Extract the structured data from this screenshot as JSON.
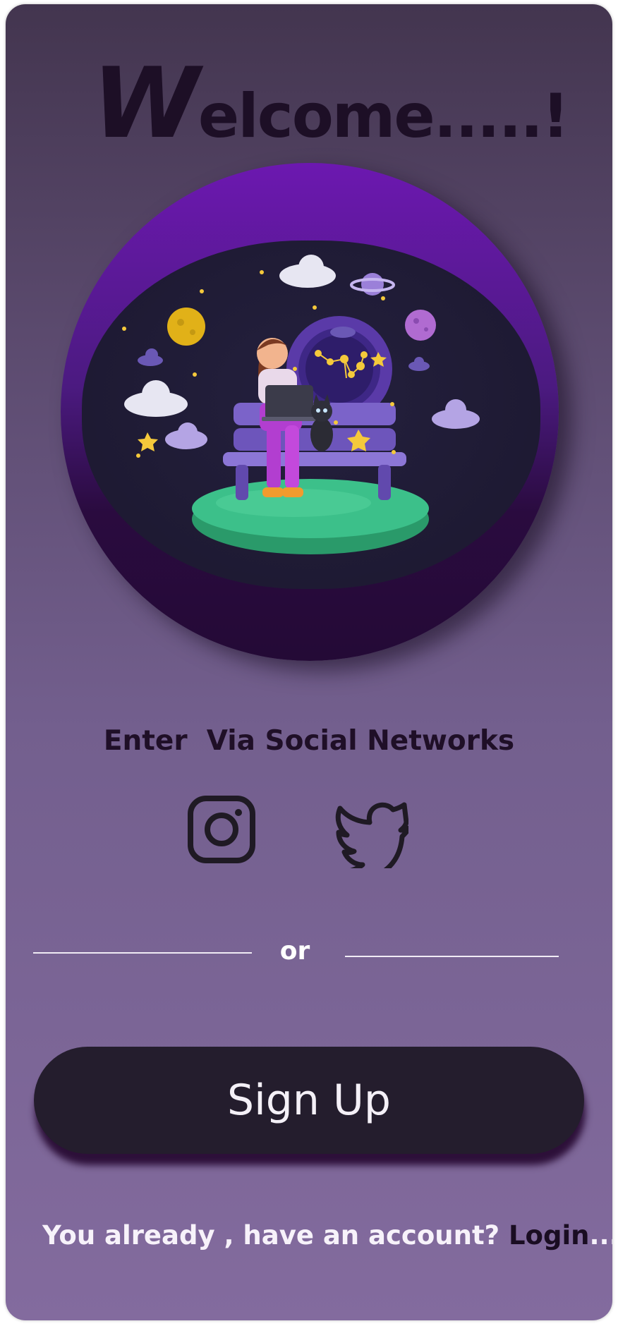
{
  "welcome": {
    "first_letter": "W",
    "rest": "elcome.....!"
  },
  "social": {
    "heading": "Enter  Via Social Networks",
    "icons": [
      "instagram-icon",
      "twitter-icon"
    ]
  },
  "divider": {
    "or_label": "or"
  },
  "signup": {
    "label": "Sign Up"
  },
  "footer": {
    "prompt": "You already , have an account? ",
    "login_label": "Login",
    "login_suffix": "....!!!"
  },
  "colors": {
    "background_top": "#43354f",
    "background_bottom": "#836b9e",
    "circle_purple": "#6c18b0",
    "button_dark": "#241d2d",
    "text_dark": "#1d0f26",
    "text_light": "#ffffff",
    "grass_green": "#3cc08a"
  }
}
